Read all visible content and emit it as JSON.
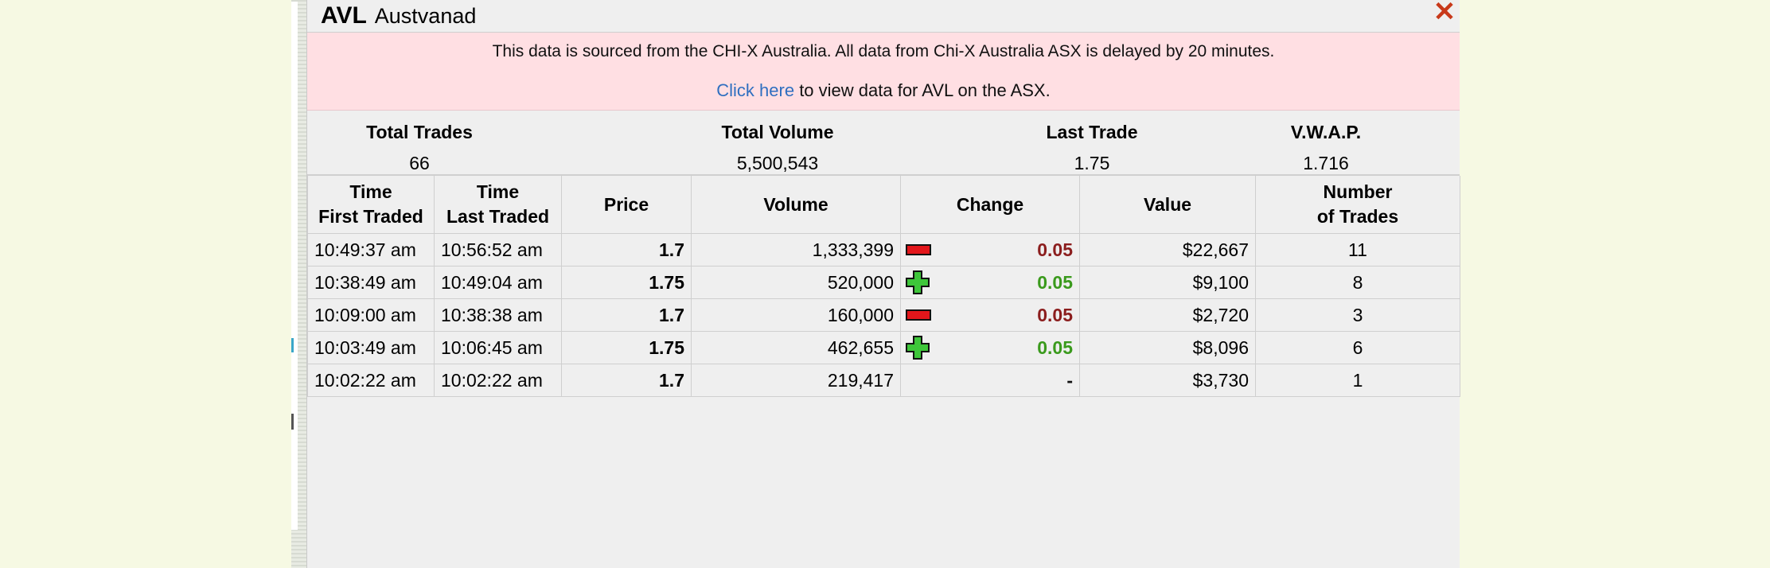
{
  "header": {
    "code": "AVL",
    "name": "Austvanad",
    "close_icon": "close-x-icon"
  },
  "notice": {
    "line1": "This data is sourced from the CHI-X Australia. All data from Chi-X Australia ASX is delayed by 20 minutes.",
    "link_text": "Click here",
    "line2_rest": " to view data for AVL on the ASX."
  },
  "summary": [
    {
      "label": "Total Trades",
      "value": "66"
    },
    {
      "label": "Total Volume",
      "value": "5,500,543"
    },
    {
      "label": "Last Trade",
      "value": "1.75"
    },
    {
      "label": "V.W.A.P.",
      "value": "1.716"
    }
  ],
  "columns": {
    "first_a": "Time",
    "first_b": "First Traded",
    "last_a": "Time",
    "last_b": "Last Traded",
    "price": "Price",
    "volume": "Volume",
    "change": "Change",
    "value": "Value",
    "num_a": "Number",
    "num_b": "of Trades"
  },
  "rows": [
    {
      "first": "10:49:37 am",
      "last": "10:56:52 am",
      "price": "1.7",
      "volume": "1,333,399",
      "dir": "down",
      "change": "0.05",
      "value": "$22,667",
      "trades": "11"
    },
    {
      "first": "10:38:49 am",
      "last": "10:49:04 am",
      "price": "1.75",
      "volume": "520,000",
      "dir": "up",
      "change": "0.05",
      "value": "$9,100",
      "trades": "8"
    },
    {
      "first": "10:09:00 am",
      "last": "10:38:38 am",
      "price": "1.7",
      "volume": "160,000",
      "dir": "down",
      "change": "0.05",
      "value": "$2,720",
      "trades": "3"
    },
    {
      "first": "10:03:49 am",
      "last": "10:06:45 am",
      "price": "1.75",
      "volume": "462,655",
      "dir": "up",
      "change": "0.05",
      "value": "$8,096",
      "trades": "6"
    },
    {
      "first": "10:02:22 am",
      "last": "10:02:22 am",
      "price": "1.7",
      "volume": "219,417",
      "dir": "none",
      "change": "-",
      "value": "$3,730",
      "trades": "1"
    }
  ],
  "colors": {
    "down": "#8b1d1d",
    "up": "#3a9a1c",
    "notice_bg": "#ffdfe3",
    "link": "#2f6fc0"
  }
}
